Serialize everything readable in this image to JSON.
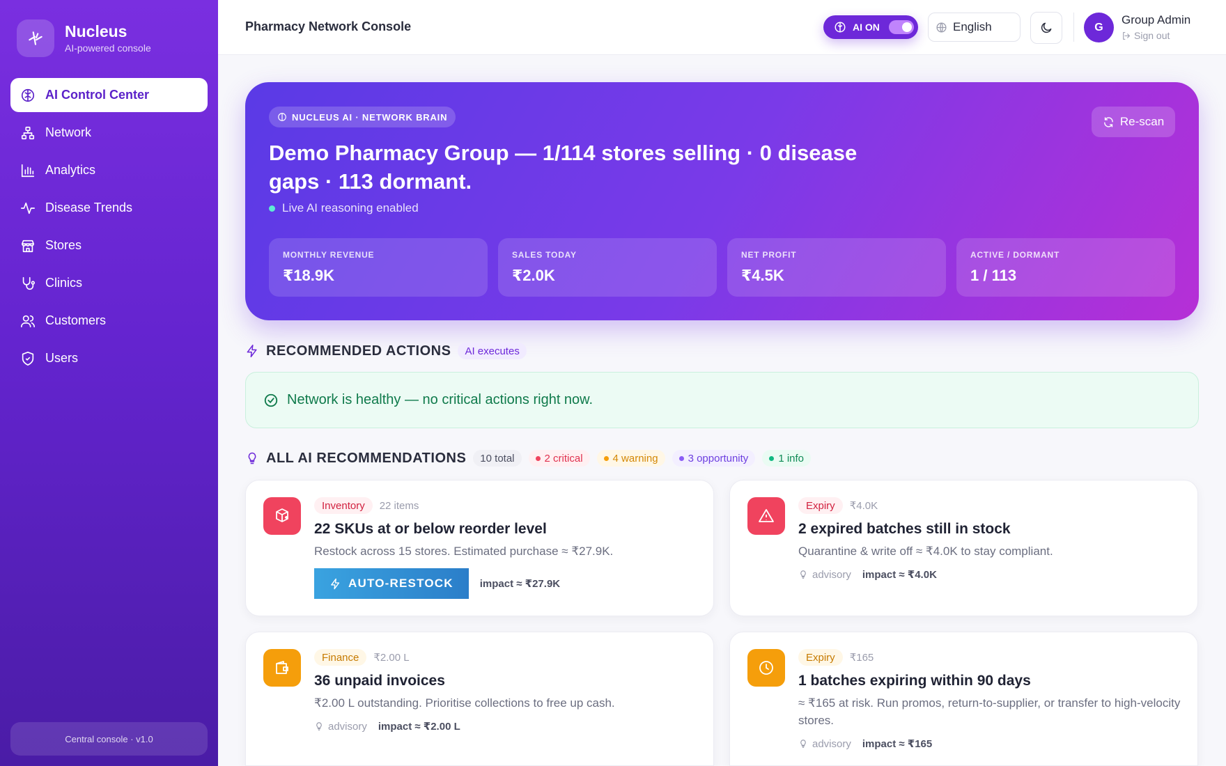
{
  "brand": {
    "name": "Nucleus",
    "subtitle": "AI-powered console"
  },
  "sidebar": {
    "items": [
      {
        "label": "AI Control Center",
        "icon": "brain-icon",
        "active": true
      },
      {
        "label": "Network",
        "icon": "network-icon"
      },
      {
        "label": "Analytics",
        "icon": "bar-chart-icon"
      },
      {
        "label": "Disease Trends",
        "icon": "pulse-icon"
      },
      {
        "label": "Stores",
        "icon": "store-icon"
      },
      {
        "label": "Clinics",
        "icon": "stethoscope-icon"
      },
      {
        "label": "Customers",
        "icon": "users-icon"
      },
      {
        "label": "Users",
        "icon": "shield-icon"
      }
    ],
    "footer": "Central console · v1.0"
  },
  "topbar": {
    "title": "Pharmacy Network Console",
    "ai_toggle": "AI ON",
    "language": "English",
    "avatar_initial": "G",
    "user_name": "Group Admin",
    "signout": "Sign out"
  },
  "hero": {
    "chip": "NUCLEUS AI · NETWORK BRAIN",
    "title": "Demo Pharmacy Group — 1/114 stores selling · 0 disease gaps · 113 dormant.",
    "live": "Live AI reasoning enabled",
    "rescan": "Re-scan",
    "stats": [
      {
        "label": "MONTHLY REVENUE",
        "value": "₹18.9K"
      },
      {
        "label": "SALES TODAY",
        "value": "₹2.0K"
      },
      {
        "label": "NET PROFIT",
        "value": "₹4.5K"
      },
      {
        "label": "ACTIVE / DORMANT",
        "value": "1 / 113"
      }
    ]
  },
  "recommended": {
    "title": "RECOMMENDED ACTIONS",
    "badge": "AI executes",
    "healthy": "Network is healthy — no critical actions right now."
  },
  "all_recs": {
    "title": "ALL AI RECOMMENDATIONS",
    "total": "10 total",
    "critical": "2 critical",
    "warning": "4 warning",
    "opportunity": "3 opportunity",
    "info": "1 info"
  },
  "cards": [
    {
      "tag": "Inventory",
      "meta": "22 items",
      "title": "22 SKUs at or below reorder level",
      "desc": "Restock across 15 stores. Estimated purchase ≈ ₹27.9K.",
      "action": "AUTO-RESTOCK",
      "impact": "impact ≈ ₹27.9K",
      "icon": "package-icon"
    },
    {
      "tag": "Expiry",
      "meta": "₹4.0K",
      "title": "2 expired batches still in stock",
      "desc": "Quarantine & write off ≈ ₹4.0K to stay compliant.",
      "advisory": "advisory",
      "impact": "impact ≈ ₹4.0K",
      "icon": "alert-triangle-icon"
    },
    {
      "tag": "Finance",
      "meta": "₹2.00 L",
      "title": "36 unpaid invoices",
      "desc": "₹2.00 L outstanding. Prioritise collections to free up cash.",
      "advisory": "advisory",
      "impact": "impact ≈ ₹2.00 L",
      "icon": "wallet-icon"
    },
    {
      "tag": "Expiry",
      "meta": "₹165",
      "title": "1 batches expiring within 90 days",
      "desc": "≈ ₹165 at risk. Run promos, return-to-supplier, or transfer to high-velocity stores.",
      "advisory": "advisory",
      "impact": "impact ≈ ₹165",
      "icon": "clock-icon"
    }
  ],
  "colors": {
    "accent": "#6d28d9",
    "critical": "#f0435e",
    "warning": "#f59e0b",
    "opportunity": "#8b5cf6",
    "info": "#10b981",
    "healthy": "#0f7a4b"
  }
}
